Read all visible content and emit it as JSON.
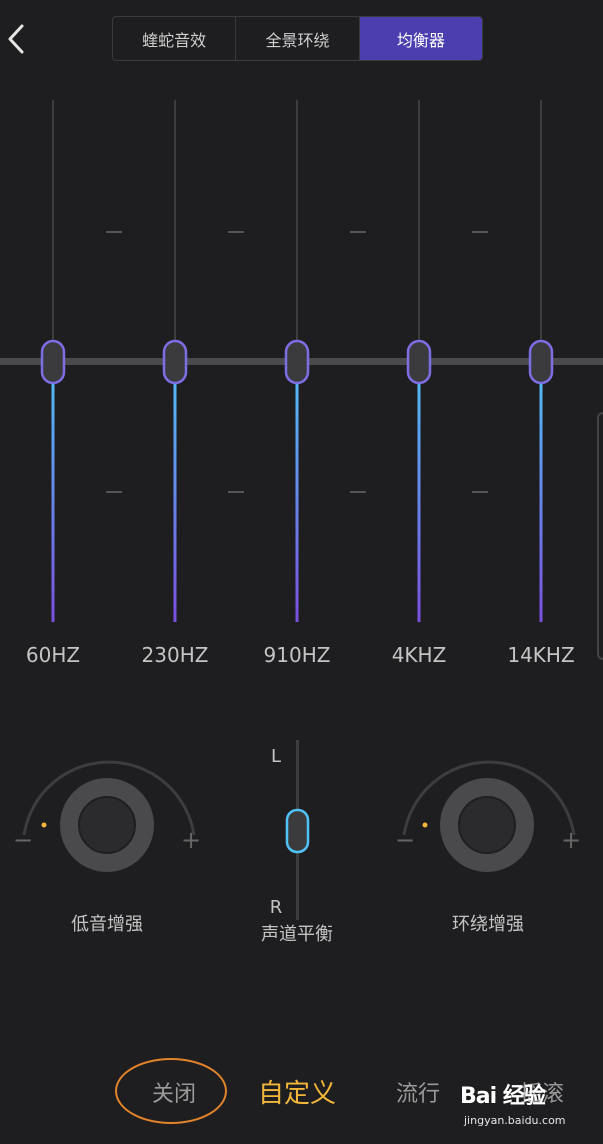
{
  "header": {
    "back_icon": "chevron-left-icon",
    "tabs": [
      {
        "label": "蝰蛇音效",
        "active": false
      },
      {
        "label": "全景环绕",
        "active": false
      },
      {
        "label": "均衡器",
        "active": true
      }
    ]
  },
  "equalizer": {
    "bands": [
      {
        "label": "60HZ",
        "level": 0
      },
      {
        "label": "230HZ",
        "level": 0
      },
      {
        "label": "910HZ",
        "level": 0
      },
      {
        "label": "4KHZ",
        "level": 0
      },
      {
        "label": "14KHZ",
        "level": 0
      }
    ],
    "colors": {
      "slider_top": "#4fc3f7",
      "slider_bottom": "#7b4fe0",
      "thumb_border": "#7e6ee6"
    }
  },
  "effects": {
    "bass": {
      "label": "低音增强",
      "minus": "−",
      "plus": "+"
    },
    "balance": {
      "label": "声道平衡",
      "left": "L",
      "right": "R"
    },
    "surround": {
      "label": "环绕增强",
      "minus": "−",
      "plus": "+"
    }
  },
  "presets": {
    "items": [
      {
        "label": "关闭",
        "active": false
      },
      {
        "label": "自定义",
        "active": true
      },
      {
        "label": "流行",
        "active": false
      },
      {
        "label": "摇滚",
        "active": false
      }
    ]
  },
  "watermark": {
    "brand": "Bai 经验",
    "url": "jingyan.baidu.com"
  }
}
